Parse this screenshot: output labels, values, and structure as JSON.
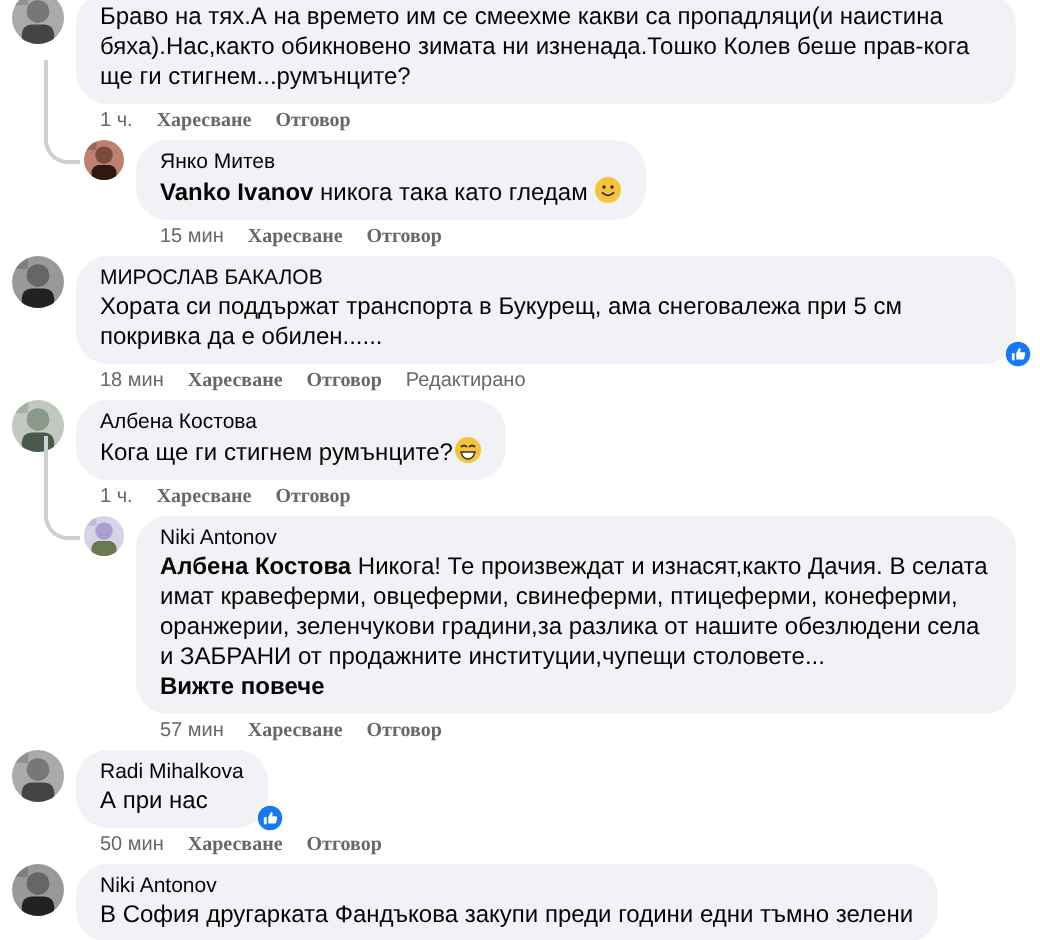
{
  "comments": [
    {
      "text": "Браво на тях.А на времето им се смеехме какви са пропадляци(и наистина бяха).Нас,както обикновено зимата ни изненада.Тошко Колев беше прав-кога ще ги стигнем...румънците?",
      "time": "1 ч.",
      "like": "Харесване",
      "reply": "Отговор",
      "replies": [
        {
          "author": "Янко Митев",
          "text": "**Vanko Ivanov** никога така като гледам",
          "emoji": {
            "kind": "smile"
          },
          "time": "15 мин",
          "like": "Харесване",
          "reply": "Отговор"
        }
      ]
    },
    {
      "author": "МИРОСЛАВ БАКАЛОВ",
      "text": "Хората си поддържат транспорта в Букурещ, ама снеговалежа при 5 см покривка да е обилен......",
      "time": "18 мин",
      "like": "Харесване",
      "reply": "Отговор",
      "edited": "Редактирано",
      "reacted": true
    },
    {
      "author": "Албена Костова",
      "text": "Кога ще ги стигнем румънците?",
      "emoji": {
        "kind": "grin"
      },
      "time": "1 ч.",
      "like": "Харесване",
      "reply": "Отговор",
      "replies": [
        {
          "author": "Niki Antonov",
          "text": "**Албена Костова** Никога! Те произвеждат и изнасят,както Дачия. В селата имат кравеферми, овцеферми, свинеферми, птицеферми, конеферми, оранжерии, зеленчукови градини,за разлика от нашите обезлюдени села и ЗАБРАНИ от продажните институции,чупещи столовете...",
          "see_more": "Вижте повече",
          "time": "57 мин",
          "like": "Харесване",
          "reply": "Отговор"
        }
      ]
    },
    {
      "author": "Radi Mihalkova",
      "text": "А при нас",
      "time": "50 мин",
      "like": "Харесване",
      "reply": "Отговор",
      "reacted": true
    },
    {
      "author": "Niki Antonov",
      "text": "В София другарката Фандъкова закупи преди години едни тъмно зелени"
    }
  ]
}
